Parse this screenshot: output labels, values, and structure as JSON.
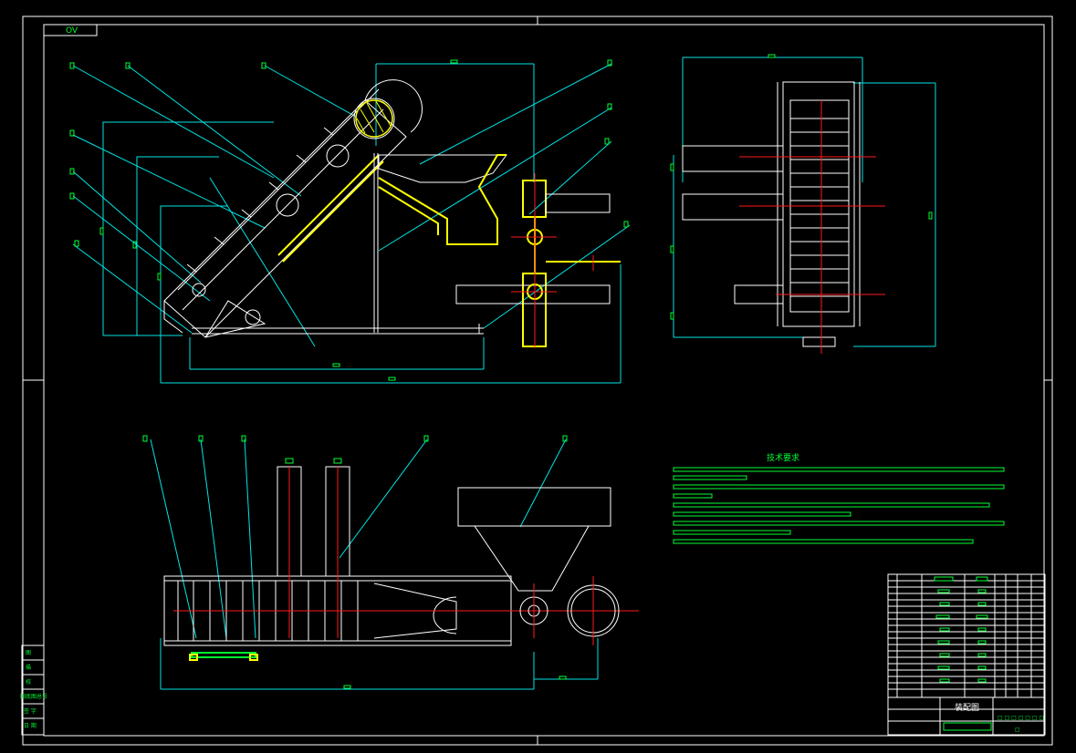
{
  "drawing": {
    "view_tag": "OV",
    "notes_title": "技术要求",
    "title_block_name": "装配图",
    "title_block_code": "□ □ □ □ □ □ □",
    "title_block_no": "□",
    "side_stamp": [
      "图",
      "描",
      "校",
      "旧底图总号",
      "签 字",
      "日 期"
    ]
  },
  "colors": {
    "background": "#000000",
    "frame": "#ffffff",
    "dimension": "#00e5e5",
    "centerline": "#ff1a1a",
    "weld": "#ffff00",
    "text": "#00ff33"
  }
}
